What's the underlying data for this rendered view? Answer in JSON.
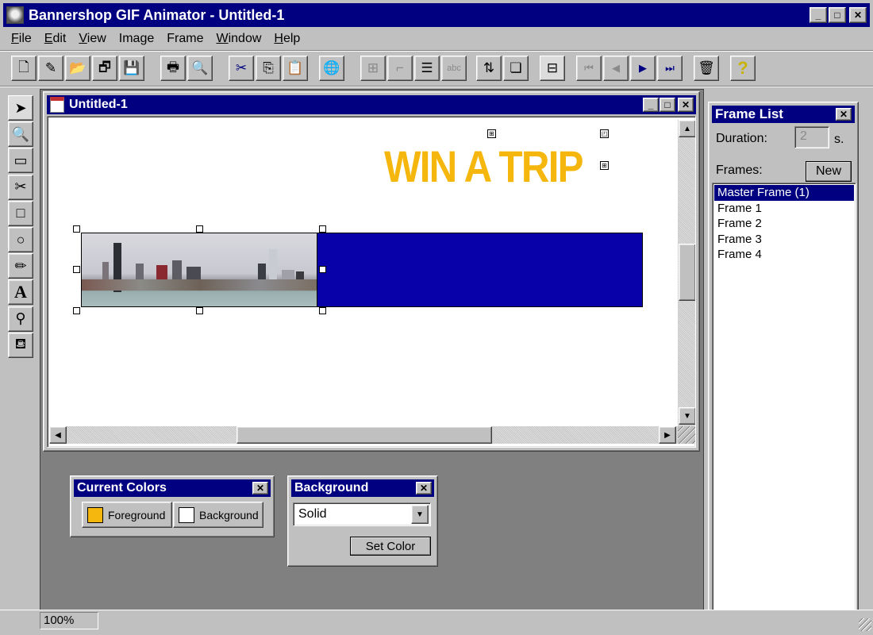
{
  "app": {
    "title": "Bannershop GIF Animator - Untitled-1",
    "window_controls": {
      "minimize": "_",
      "maximize": "□",
      "close": "✕"
    }
  },
  "menu": [
    {
      "label": "File",
      "accel": "F",
      "rest": "ile"
    },
    {
      "label": "Edit",
      "accel": "E",
      "rest": "dit"
    },
    {
      "label": "View",
      "accel": "V",
      "rest": "iew"
    },
    {
      "label": "Image",
      "accel": "",
      "rest": "Image"
    },
    {
      "label": "Frame",
      "accel": "",
      "rest": "Frame"
    },
    {
      "label": "Window",
      "accel": "W",
      "rest": "indow"
    },
    {
      "label": "Help",
      "accel": "H",
      "rest": "elp"
    }
  ],
  "toolbar": [
    {
      "name": "new-icon",
      "glyph": "🗋",
      "enabled": true
    },
    {
      "name": "wizard-icon",
      "glyph": "✎",
      "enabled": true
    },
    {
      "name": "open-icon",
      "glyph": "📂",
      "enabled": true
    },
    {
      "name": "save-all-icon",
      "glyph": "🗗",
      "enabled": true
    },
    {
      "name": "save-icon",
      "glyph": "💾",
      "enabled": true
    },
    {
      "name": "print-icon",
      "glyph": "🖶",
      "enabled": true
    },
    {
      "name": "print-preview-icon",
      "glyph": "🔍",
      "enabled": true
    },
    {
      "name": "cut-icon",
      "glyph": "✂",
      "enabled": true
    },
    {
      "name": "copy-icon",
      "glyph": "⎘",
      "enabled": true
    },
    {
      "name": "paste-icon",
      "glyph": "📋",
      "enabled": true
    },
    {
      "name": "preview-browser-icon",
      "glyph": "🌐",
      "enabled": true
    },
    {
      "name": "crop-icon",
      "glyph": "⊞",
      "enabled": false
    },
    {
      "name": "resize-icon",
      "glyph": "⌐",
      "enabled": false
    },
    {
      "name": "import-frames-icon",
      "glyph": "☰",
      "enabled": true
    },
    {
      "name": "text-icon",
      "glyph": "abc",
      "enabled": false
    },
    {
      "name": "transition-icon",
      "glyph": "⇅",
      "enabled": true
    },
    {
      "name": "new-frame-icon",
      "glyph": "❏",
      "enabled": true
    },
    {
      "name": "layout-icon",
      "glyph": "⊟",
      "enabled": true
    },
    {
      "name": "first-frame-icon",
      "glyph": "⏮",
      "enabled": false
    },
    {
      "name": "prev-frame-icon",
      "glyph": "◀",
      "enabled": false
    },
    {
      "name": "next-frame-icon",
      "glyph": "▶",
      "enabled": true
    },
    {
      "name": "last-frame-icon",
      "glyph": "⏭",
      "enabled": true
    },
    {
      "name": "delete-icon",
      "glyph": "🗑",
      "enabled": true
    },
    {
      "name": "help-icon",
      "glyph": "?",
      "enabled": true
    }
  ],
  "tools": [
    {
      "name": "select-tool",
      "glyph": "➤"
    },
    {
      "name": "zoom-tool",
      "glyph": "🔍"
    },
    {
      "name": "image-tool",
      "glyph": "▭"
    },
    {
      "name": "crop-tool",
      "glyph": "✂"
    },
    {
      "name": "rectangle-tool",
      "glyph": "□"
    },
    {
      "name": "ellipse-tool",
      "glyph": "○"
    },
    {
      "name": "pencil-tool",
      "glyph": "✏"
    },
    {
      "name": "text-tool",
      "glyph": "A"
    },
    {
      "name": "eyedropper-tool",
      "glyph": "⚲"
    },
    {
      "name": "fill-tool",
      "glyph": "⛾"
    }
  ],
  "document": {
    "title": "Untitled-1",
    "banner_text": "WIN A TRIP",
    "banner_text_color": "#f5b70d",
    "banner_bar_color": "#0800a8"
  },
  "frame_list": {
    "title": "Frame List",
    "duration_label": "Duration:",
    "duration_value": "2",
    "duration_unit": "s.",
    "frames_label": "Frames:",
    "new_button": "New",
    "frames": [
      "Master Frame (1)",
      "Frame 1",
      "Frame 2",
      "Frame 3",
      "Frame 4"
    ],
    "selected_index": 0
  },
  "current_colors": {
    "title": "Current Colors",
    "foreground_label": "Foreground",
    "foreground_color": "#f5b70d",
    "background_label": "Background",
    "background_color": "#ffffff"
  },
  "background_panel": {
    "title": "Background",
    "fill_type": "Solid",
    "set_color_button": "Set Color"
  },
  "status": {
    "zoom": "100%"
  }
}
